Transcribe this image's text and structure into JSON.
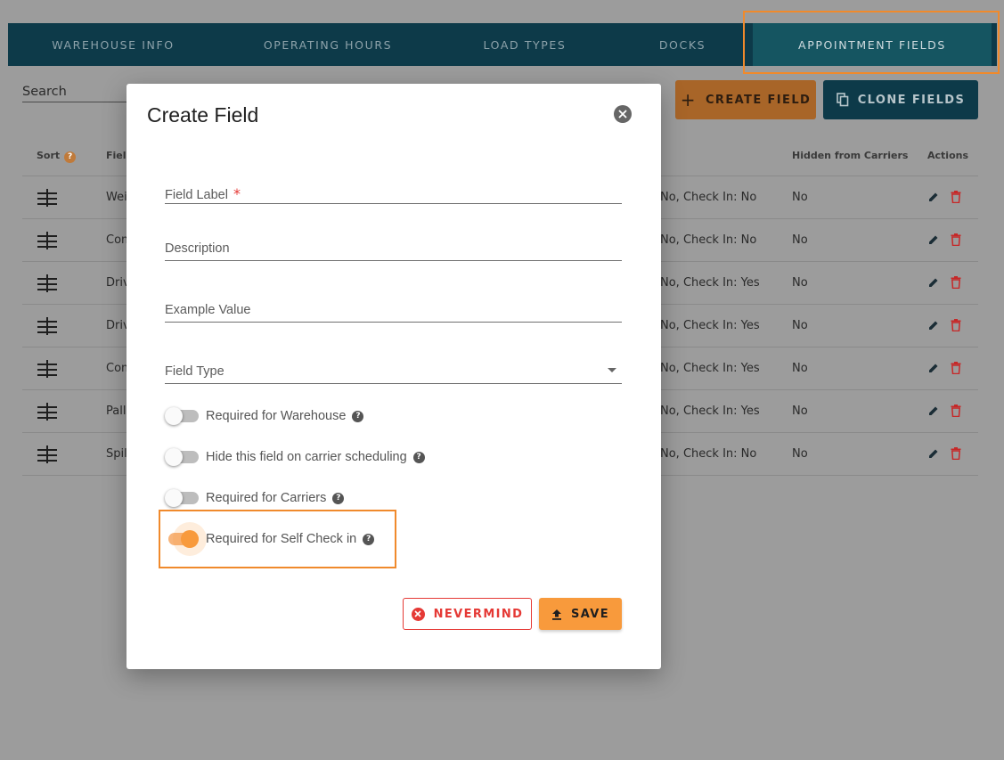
{
  "tabs": [
    {
      "label": "WAREHOUSE INFO"
    },
    {
      "label": "OPERATING HOURS"
    },
    {
      "label": "LOAD TYPES"
    },
    {
      "label": "DOCKS"
    },
    {
      "label": "APPOINTMENT FIELDS",
      "active": true
    }
  ],
  "search": {
    "label": "Search"
  },
  "actions": {
    "create_label": "CREATE FIELD",
    "clone_label": "CLONE FIELDS"
  },
  "table": {
    "headers": {
      "sort": "Sort",
      "field": "Field",
      "hidden": "Hidden from Carriers",
      "actions": "Actions"
    },
    "rows": [
      {
        "name": "Wei",
        "required": "No, Check In: No",
        "hidden": "No"
      },
      {
        "name": "Com",
        "required": "No, Check In: No",
        "hidden": "No"
      },
      {
        "name": "Driv",
        "required": "No, Check In: Yes",
        "hidden": "No"
      },
      {
        "name": "Driv",
        "required": "No, Check In: Yes",
        "hidden": "No"
      },
      {
        "name": "Com",
        "required": "No, Check In: Yes",
        "hidden": "No"
      },
      {
        "name": "Pall",
        "required": "No, Check In: Yes",
        "hidden": "No"
      },
      {
        "name": "Spil",
        "required": "No, Check In: No",
        "hidden": "No"
      }
    ]
  },
  "modal": {
    "title": "Create Field",
    "fields": {
      "label": "Field Label",
      "required_mark": "*",
      "description": "Description",
      "example": "Example Value",
      "type": "Field Type"
    },
    "toggles": [
      {
        "label": "Required for Warehouse",
        "on": false
      },
      {
        "label": "Hide this field on carrier scheduling",
        "on": false
      },
      {
        "label": "Required for Carriers",
        "on": false
      },
      {
        "label": "Required for Self Check in",
        "on": true
      }
    ],
    "buttons": {
      "nevermind": "NEVERMIND",
      "save": "SAVE"
    }
  },
  "colors": {
    "accent": "#f89a3c",
    "navy": "#0d3a49",
    "danger": "#e53935"
  }
}
